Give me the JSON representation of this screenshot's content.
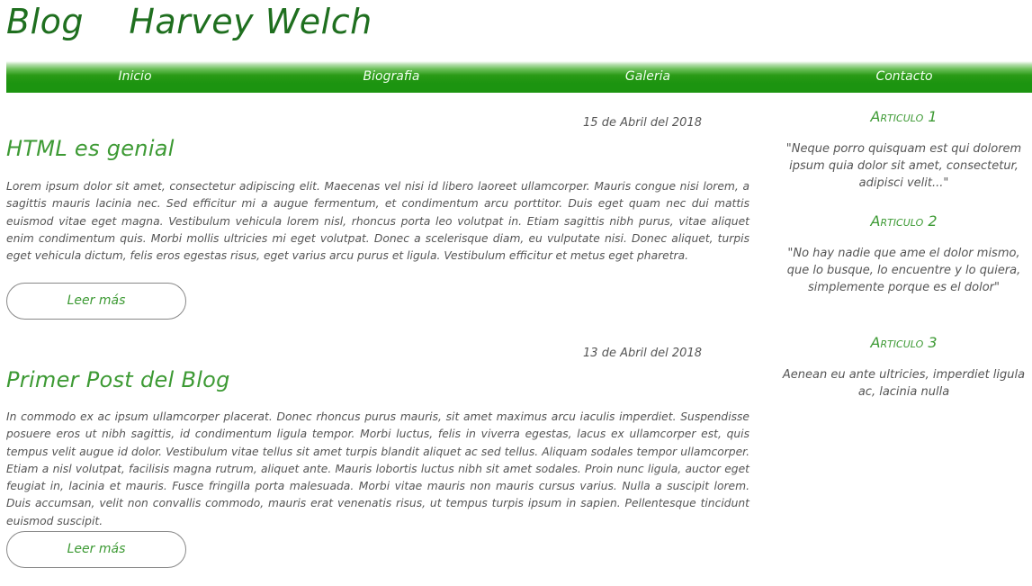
{
  "site": {
    "title": "Blog    Harvey Welch"
  },
  "nav": {
    "items": [
      {
        "label": "Inicio"
      },
      {
        "label": "Biografia"
      },
      {
        "label": "Galeria"
      },
      {
        "label": "Contacto"
      }
    ]
  },
  "posts": [
    {
      "date": "15 de Abril del 2018",
      "title": "HTML es genial",
      "body": "Lorem ipsum dolor sit amet, consectetur adipiscing elit. Maecenas vel nisi id libero laoreet ullamcorper. Mauris congue nisi lorem, a sagittis mauris lacinia nec. Sed efficitur mi a augue fermentum, et condimentum arcu porttitor. Duis eget quam nec dui mattis euismod vitae eget magna. Vestibulum vehicula lorem nisl, rhoncus porta leo volutpat in. Etiam sagittis nibh purus, vitae aliquet enim condimentum quis. Morbi mollis ultricies mi eget volutpat. Donec a scelerisque diam, eu vulputate nisi. Donec aliquet, turpis eget vehicula dictum, felis eros egestas risus, eget varius arcu purus et ligula. Vestibulum efficitur et metus eget pharetra.",
      "read_more": "Leer más"
    },
    {
      "date": "13 de Abril del 2018",
      "title": "Primer Post del Blog",
      "body": "In commodo ex ac ipsum ullamcorper placerat. Donec rhoncus purus mauris, sit amet maximus arcu iaculis imperdiet. Suspendisse posuere eros ut nibh sagittis, id condimentum ligula tempor. Morbi luctus, felis in viverra egestas, lacus ex ullamcorper est, quis tempus velit augue id dolor. Vestibulum vitae tellus sit amet turpis blandit aliquet ac sed tellus. Aliquam sodales tempor ullamcorper. Etiam a nisl volutpat, facilisis magna rutrum, aliquet ante. Mauris lobortis luctus nibh sit amet sodales. Proin nunc ligula, auctor eget feugiat in, lacinia et mauris. Fusce fringilla porta malesuada. Morbi vitae mauris non mauris cursus varius. Nulla a suscipit lorem. Duis accumsan, velit non convallis commodo, mauris erat venenatis risus, ut tempus turpis ipsum in sapien. Pellentesque tincidunt euismod suscipit.",
      "read_more": "Leer más"
    }
  ],
  "sidebar": {
    "articles": [
      {
        "heading": "Articulo 1",
        "quote": "\"Neque porro quisquam est qui dolorem ipsum quia dolor sit amet, consectetur, adipisci velit...\""
      },
      {
        "heading": "Articulo 2",
        "quote": "\"No hay nadie que ame el dolor mismo, que lo busque, lo encuentre y lo quiera, simplemente porque es el dolor\""
      },
      {
        "heading": "Articulo 3",
        "quote": "Aenean eu ante ultricies, imperdiet ligula ac, lacinia nulla"
      }
    ]
  },
  "colors": {
    "accent": "#3d9a34",
    "nav_bg": "#1c9410",
    "title": "#1f6f1f"
  }
}
